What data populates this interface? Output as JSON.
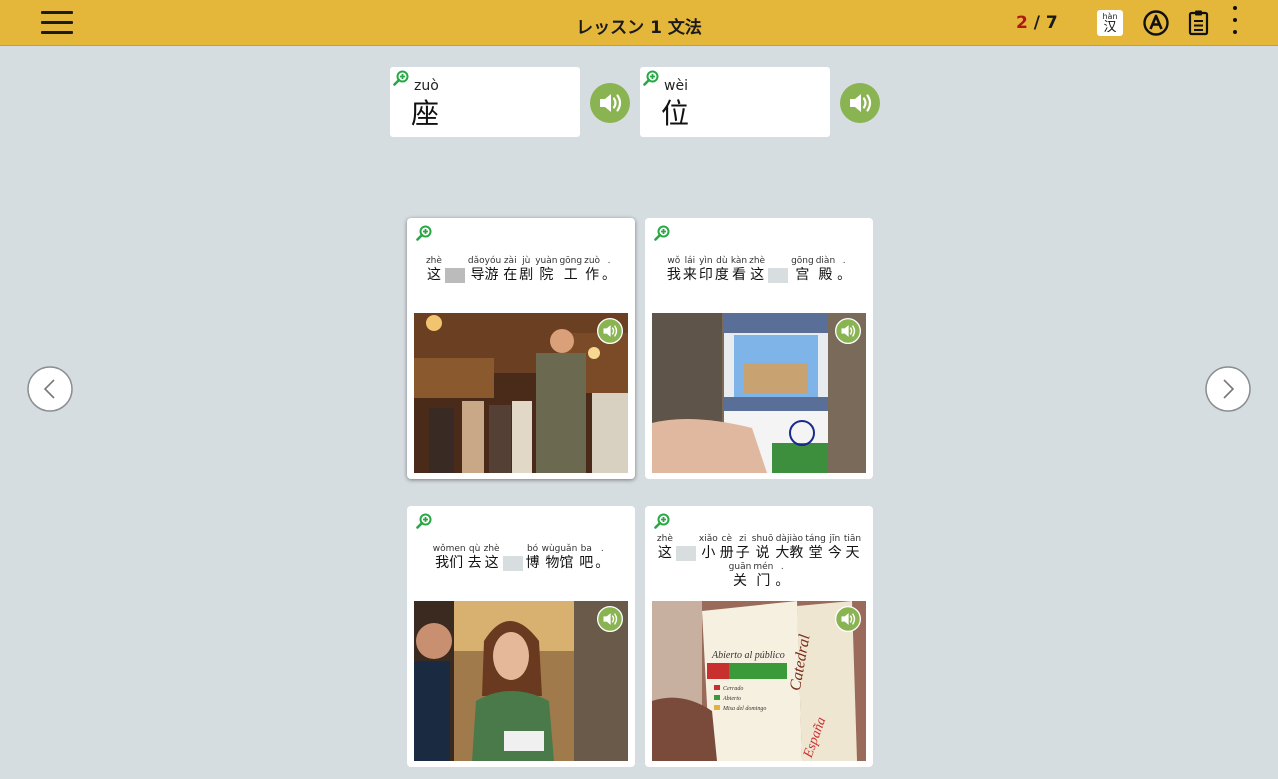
{
  "header": {
    "title": "レッスン 1 文法",
    "progress_current": "2",
    "progress_sep": " / ",
    "progress_total": "7",
    "hanzi_pinyin": "hàn",
    "hanzi_char": "汉"
  },
  "vocab": [
    {
      "pinyin": "zuò",
      "char": "座"
    },
    {
      "pinyin": "wèi",
      "char": "位"
    }
  ],
  "cards": [
    {
      "lines": [
        [
          {
            "p": "zhè",
            "c": "这"
          },
          {
            "blank": true
          },
          {
            "p": "dǎoyóu",
            "c": "导游"
          },
          {
            "p": "zài",
            "c": "在"
          },
          {
            "p": "jù",
            "c": "剧"
          },
          {
            "p": "yuàn",
            "c": "院"
          },
          {
            "p": "gōng",
            "c": "工"
          },
          {
            "p": "zuò",
            "c": "作"
          },
          {
            "p": ".",
            "c": "。"
          }
        ]
      ],
      "photo": "tour-guide-theater-photo"
    },
    {
      "lines": [
        [
          {
            "p": "wǒ",
            "c": "我"
          },
          {
            "p": "lái",
            "c": "来"
          },
          {
            "p": "yìn",
            "c": "印"
          },
          {
            "p": "dù",
            "c": "度"
          },
          {
            "p": "kàn",
            "c": "看"
          },
          {
            "p": "zhè",
            "c": "这"
          },
          {
            "blank": true,
            "light": true
          },
          {
            "p": "gōng",
            "c": "宫"
          },
          {
            "p": "diàn",
            "c": "殿"
          },
          {
            "p": ".",
            "c": "。"
          }
        ]
      ],
      "photo": "india-palace-postcard-photo"
    },
    {
      "lines": [
        [
          {
            "p": "wǒmen",
            "c": "我们"
          },
          {
            "p": "qù",
            "c": "去"
          },
          {
            "p": "zhè",
            "c": "这"
          },
          {
            "blank": true,
            "light": true
          },
          {
            "p": "bó",
            "c": "博"
          },
          {
            "p": "wùguǎn",
            "c": "物馆"
          },
          {
            "p": "ba",
            "c": "吧"
          },
          {
            "p": ".",
            "c": "。"
          }
        ]
      ],
      "photo": "friends-cafe-photo"
    },
    {
      "lines": [
        [
          {
            "p": "zhè",
            "c": "这"
          },
          {
            "blank": true,
            "light": true
          },
          {
            "p": "xiǎo",
            "c": "小"
          },
          {
            "p": "cè",
            "c": "册"
          },
          {
            "p": "zi",
            "c": "子"
          },
          {
            "p": "shuō",
            "c": "说"
          },
          {
            "p": "dàjiào",
            "c": "大教"
          },
          {
            "p": "táng",
            "c": "堂"
          },
          {
            "p": "jīn",
            "c": "今"
          },
          {
            "p": "tiān",
            "c": "天"
          }
        ],
        [
          {
            "p": "guān",
            "c": "关"
          },
          {
            "p": "mén",
            "c": "门"
          },
          {
            "p": ".",
            "c": "。"
          }
        ]
      ],
      "photo": "brochure-abierto-photo",
      "brochure_title": "Abierto al público",
      "brochure_items": [
        "Cerrado",
        "Abierto",
        "Misa del domingo"
      ],
      "brochure_side": "Catedral",
      "brochure_bottom": "España"
    }
  ],
  "colors": {
    "topbar": "#e4b73a",
    "background": "#d6dde1",
    "speaker_green": "#8ab352",
    "zoom_green": "#27a844",
    "progress_current": "#b01818"
  },
  "icons": [
    "menu-icon",
    "hanzi-toggle-icon",
    "auto-play-icon",
    "notes-icon",
    "more-icon",
    "zoom-in-icon",
    "speaker-icon",
    "chevron-left-icon",
    "chevron-right-icon"
  ]
}
